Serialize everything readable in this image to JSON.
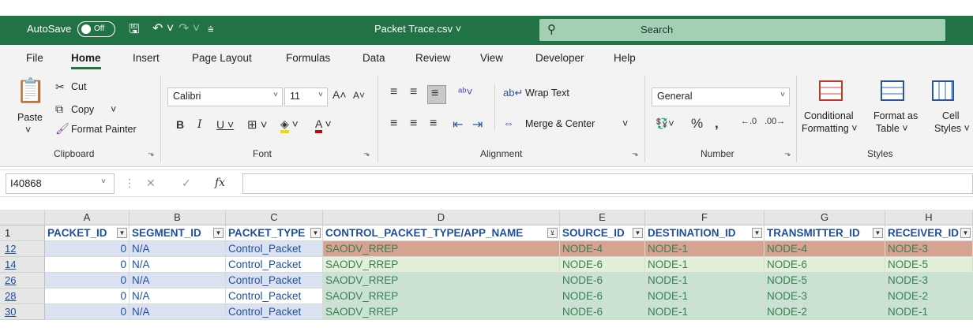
{
  "titlebar": {
    "autosave_label": "AutoSave",
    "autosave_state": "Off",
    "document_title": "Packet Trace.csv ˅",
    "search_placeholder": "Search",
    "accent_color": "#217346"
  },
  "menu": {
    "tabs": [
      "File",
      "Home",
      "Insert",
      "Page Layout",
      "Formulas",
      "Data",
      "Review",
      "View",
      "Developer",
      "Help"
    ],
    "active_tab": "Home"
  },
  "ribbon": {
    "clipboard": {
      "paste": "Paste",
      "cut": "Cut",
      "copy": "Copy",
      "format_painter": "Format Painter",
      "label": "Clipboard"
    },
    "font": {
      "font_name": "Calibri",
      "font_size": "11",
      "label": "Font"
    },
    "alignment": {
      "wrap_text": "Wrap Text",
      "merge_center": "Merge & Center",
      "label": "Alignment"
    },
    "number": {
      "format": "General",
      "label": "Number"
    },
    "styles": {
      "conditional_1": "Conditional",
      "conditional_2": "Formatting ˅",
      "format_table_1": "Format as",
      "format_table_2": "Table ˅",
      "cell_styles_1": "Cell",
      "cell_styles_2": "Styles ˅",
      "label": "Styles"
    }
  },
  "formula_bar": {
    "name_box": "I40868",
    "formula": ""
  },
  "sheet": {
    "column_letters": [
      "A",
      "B",
      "C",
      "D",
      "E",
      "F",
      "G",
      "H"
    ],
    "headers": [
      "PACKET_ID",
      "SEGMENT_ID",
      "PACKET_TYPE",
      "CONTROL_PACKET_TYPE/APP_NAME",
      "SOURCE_ID",
      "DESTINATION_ID",
      "TRANSMITTER_ID",
      "RECEIVER_ID"
    ],
    "header_row_number": "1",
    "rows": [
      {
        "row": "12",
        "cells": [
          "0",
          "N/A",
          "Control_Packet",
          "SAODV_RREP",
          "NODE-4",
          "NODE-1",
          "NODE-4",
          "NODE-3"
        ]
      },
      {
        "row": "14",
        "cells": [
          "0",
          "N/A",
          "Control_Packet",
          "SAODV_RREP",
          "NODE-6",
          "NODE-1",
          "NODE-6",
          "NODE-5"
        ]
      },
      {
        "row": "26",
        "cells": [
          "0",
          "N/A",
          "Control_Packet",
          "SAODV_RREP",
          "NODE-6",
          "NODE-1",
          "NODE-5",
          "NODE-3"
        ]
      },
      {
        "row": "28",
        "cells": [
          "0",
          "N/A",
          "Control_Packet",
          "SAODV_RREP",
          "NODE-6",
          "NODE-1",
          "NODE-3",
          "NODE-2"
        ]
      },
      {
        "row": "30",
        "cells": [
          "0",
          "N/A",
          "Control_Packet",
          "SAODV_RREP",
          "NODE-6",
          "NODE-1",
          "NODE-2",
          "NODE-1"
        ]
      }
    ],
    "colors": {
      "blue_band": "#dae2f2",
      "red_row": "#d6a390",
      "light_green": "#e2efda",
      "mid_green": "#c9e2d2",
      "link_blue": "#1f4e9c"
    }
  }
}
